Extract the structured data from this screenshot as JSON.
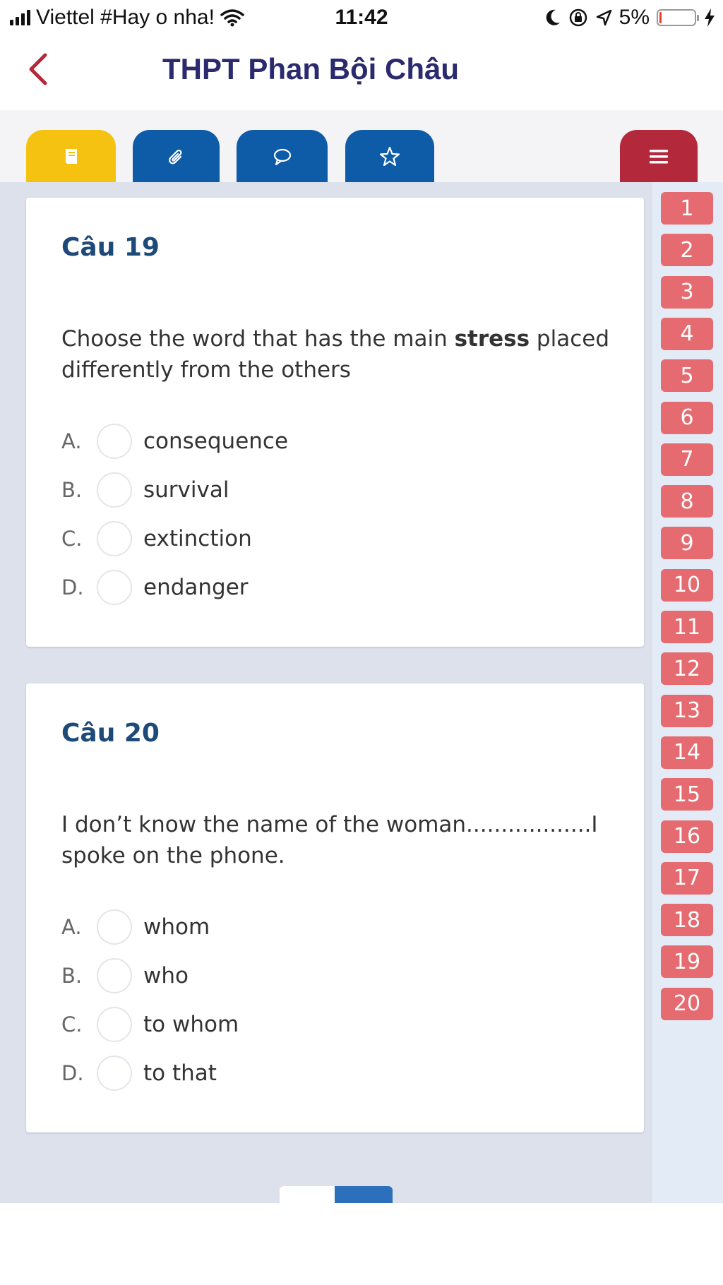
{
  "status_bar": {
    "carrier": "Viettel #Hay o nha!",
    "time": "11:42",
    "battery_percent": "5%",
    "battery_level": 0.05
  },
  "nav": {
    "title": "THPT Phan Bội Châu",
    "accent_color": "#b3283a"
  },
  "toolbar": {
    "buttons": [
      {
        "icon": "book-icon",
        "color": "#f5c211"
      },
      {
        "icon": "paperclip-icon",
        "color": "#0e5ca8"
      },
      {
        "icon": "comment-icon",
        "color": "#0e5ca8"
      },
      {
        "icon": "star-icon",
        "color": "#0e5ca8"
      }
    ],
    "menu": {
      "icon": "menu-icon",
      "color": "#b3283a"
    }
  },
  "sidebar": {
    "numbers": [
      "1",
      "2",
      "3",
      "4",
      "5",
      "6",
      "7",
      "8",
      "9",
      "10",
      "11",
      "12",
      "13",
      "14",
      "15",
      "16",
      "17",
      "18",
      "19",
      "20"
    ],
    "color": "#e56b70"
  },
  "questions": [
    {
      "title": "Câu 19",
      "text_before": "Choose the word that has the main ",
      "text_bold": "stress",
      "text_after": " placed differently from the others",
      "options": [
        {
          "letter": "A.",
          "text": "consequence"
        },
        {
          "letter": "B.",
          "text": "survival"
        },
        {
          "letter": "C.",
          "text": "extinction"
        },
        {
          "letter": "D.",
          "text": "endanger"
        }
      ]
    },
    {
      "title": "Câu 20",
      "text": "I don’t know the name of the woman..................I spoke on the phone.",
      "options": [
        {
          "letter": "A.",
          "text": "whom"
        },
        {
          "letter": "B.",
          "text": "who"
        },
        {
          "letter": "C.",
          "text": "to whom"
        },
        {
          "letter": "D.",
          "text": "to that"
        }
      ]
    }
  ]
}
